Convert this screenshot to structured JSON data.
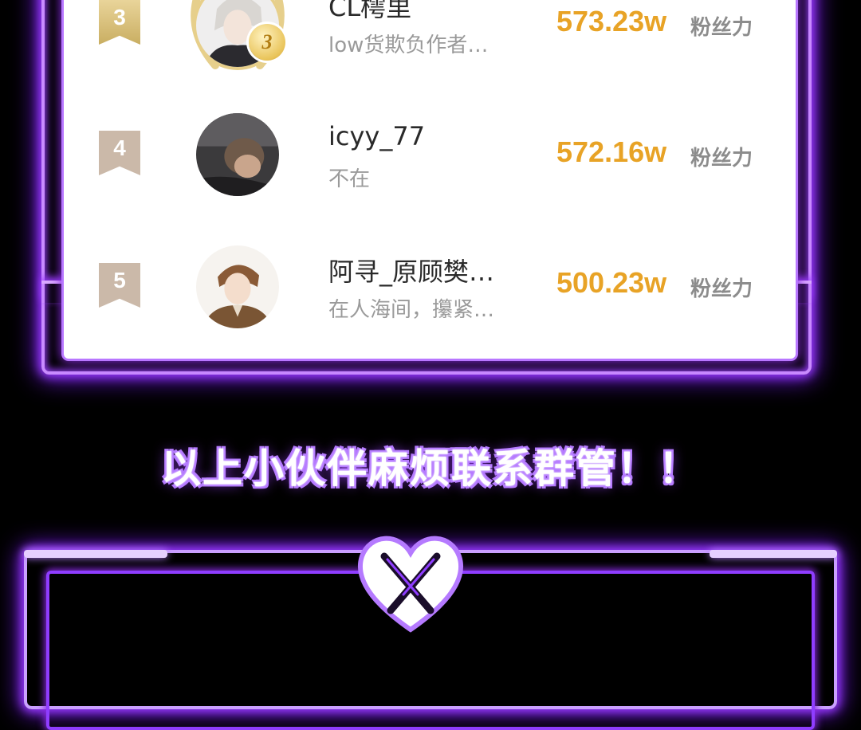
{
  "colors": {
    "neon": "#b877ff",
    "score": "#e8a326",
    "rank_gold": "#c9ae62",
    "rank_plain": "#cbb9a9"
  },
  "ranking": [
    {
      "rank": "3",
      "name": "CL樗里",
      "subtitle": "low货欺负作者…",
      "score": "573.23w",
      "score_unit": "粉丝力",
      "medal": "3",
      "avatar_icon": "silver-hair-character-avatar"
    },
    {
      "rank": "4",
      "name": "icyy_77",
      "subtitle": "不在",
      "score": "572.16w",
      "score_unit": "粉丝力",
      "avatar_icon": "photo-avatar"
    },
    {
      "rank": "5",
      "name": "阿寻_原顾樊…",
      "subtitle": "在人海间，攥紧…",
      "score": "500.23w",
      "score_unit": "粉丝力",
      "avatar_icon": "suited-character-avatar"
    }
  ],
  "notice": "以上小伙伴麻烦联系群管！！",
  "bottom": {
    "icon": "heart-crossed-knives-icon"
  }
}
